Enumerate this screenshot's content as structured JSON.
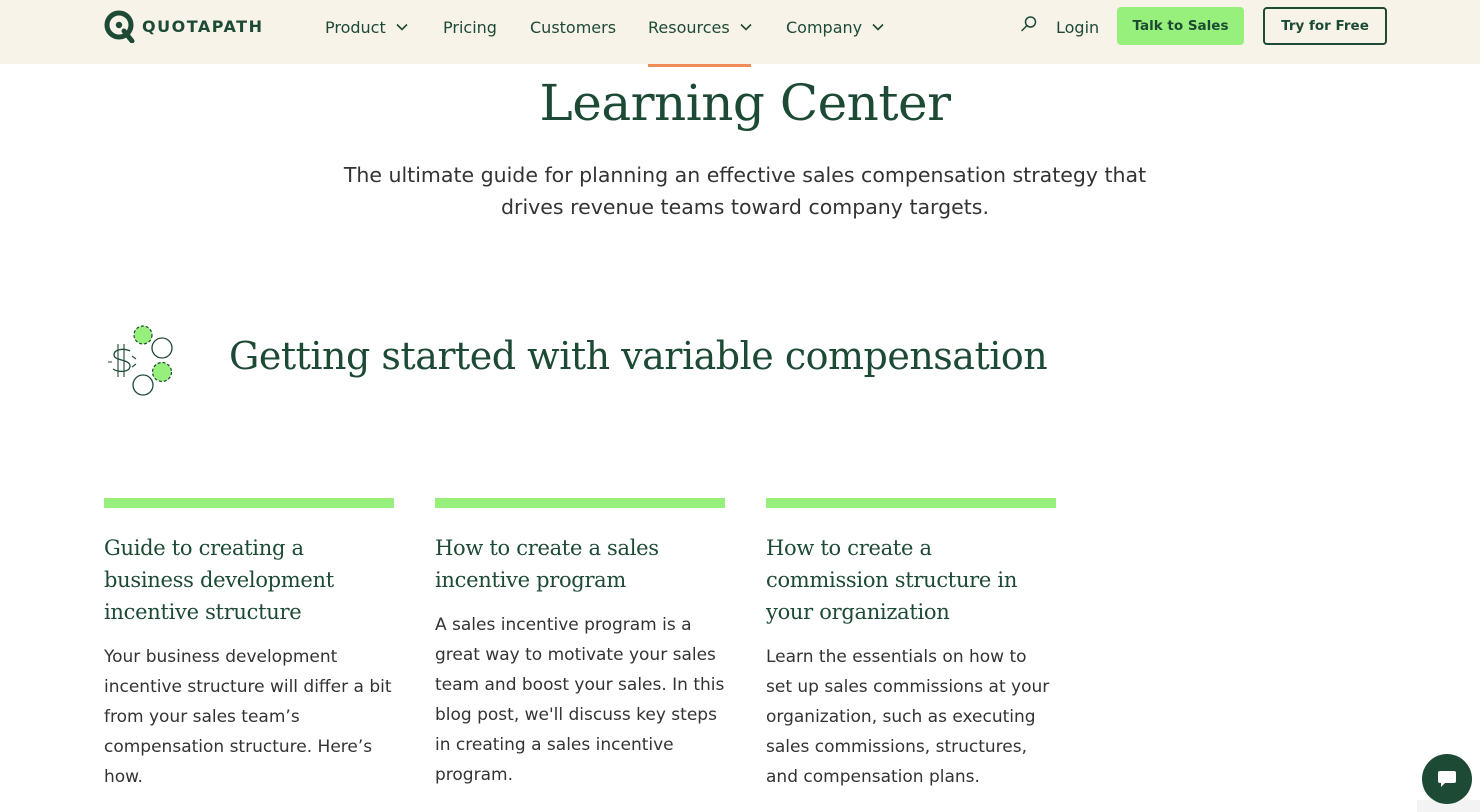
{
  "nav": {
    "logo_text": "QUOTAPATH",
    "links": [
      {
        "label": "Product"
      },
      {
        "label": "Pricing"
      },
      {
        "label": "Customers"
      },
      {
        "label": "Resources"
      },
      {
        "label": "Company"
      }
    ],
    "login_label": "Login",
    "talk_label": "Talk to Sales",
    "try_label": "Try for Free"
  },
  "hero": {
    "title": "Learning Center",
    "subtitle": "The ultimate guide for planning an effective sales compensation strategy that drives revenue teams toward company targets."
  },
  "section": {
    "title": "Getting started with variable compensation"
  },
  "cards": [
    {
      "title": "Guide to creating a business development incentive structure",
      "description": "Your business development incentive structure will differ a bit from your sales team’s compensation structure. Here’s how."
    },
    {
      "title": "How to create a sales incentive program",
      "description": "A sales incentive program is a great way to motivate your sales team and boost your sales. In this blog post, we'll discuss key steps in creating a sales incentive program."
    },
    {
      "title": "How to create a commission structure in your organization",
      "description": "Learn the essentials on how to set up sales commissions at your organization, such as executing sales commissions, structures, and compensation plans."
    }
  ],
  "colors": {
    "brand_green": "#1d4a35",
    "accent_lime": "#96f07b",
    "nav_bg": "#f7f3e8",
    "active_underline": "#f08b5a"
  },
  "icons": [
    "quotapath-logo-icon",
    "chevron-down-icon",
    "search-icon",
    "compensation-coins-icon",
    "chat-icon"
  ]
}
